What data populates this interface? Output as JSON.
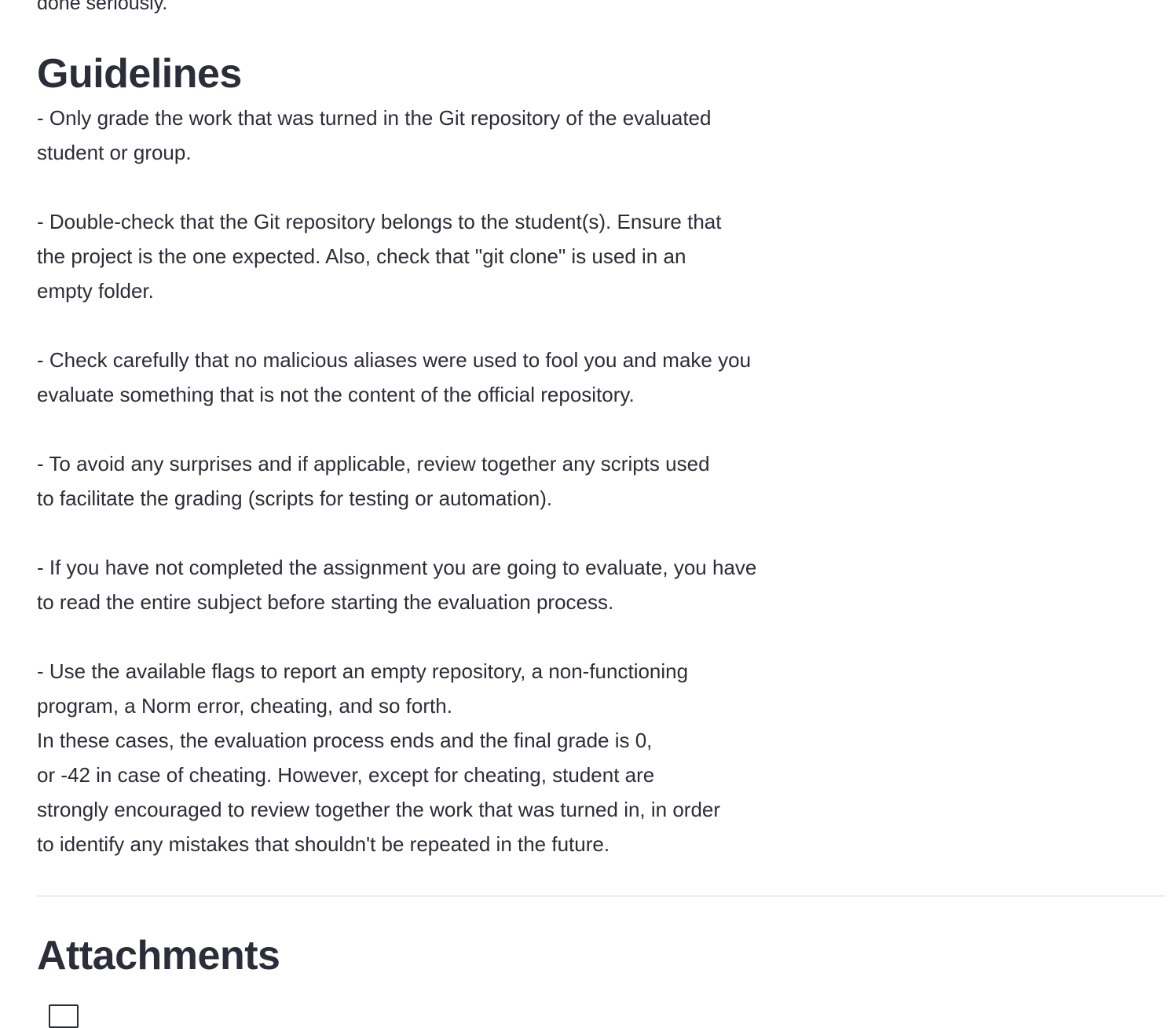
{
  "intro": {
    "cut_off_line": "done seriously."
  },
  "guidelines": {
    "title": "Guidelines",
    "lines": [
      "- Only grade the work that was turned in the Git repository of the evaluated",
      "student or group.",
      "",
      "- Double-check that the Git repository belongs to the student(s). Ensure that",
      "the project is the one expected. Also, check that \"git clone\" is used in an",
      "empty folder.",
      "",
      "- Check carefully that no malicious aliases were used to fool you and make you",
      "evaluate something that is not the content of the official repository.",
      "",
      "- To avoid any surprises and if applicable, review together any scripts used",
      "to facilitate the grading (scripts for testing or automation).",
      "",
      "- If you have not completed the assignment you are going to evaluate, you have",
      "to read the entire subject before starting the evaluation process.",
      "",
      "- Use the available flags to report an empty repository, a non-functioning",
      "program, a Norm error, cheating, and so forth.",
      "In these cases, the evaluation process ends and the final grade is 0,",
      "or -42 in case of cheating. However, except for cheating, student are",
      "strongly encouraged to review together the work that was turned in, in order",
      "to identify any mistakes that shouldn't be repeated in the future."
    ]
  },
  "attachments": {
    "title": "Attachments"
  }
}
